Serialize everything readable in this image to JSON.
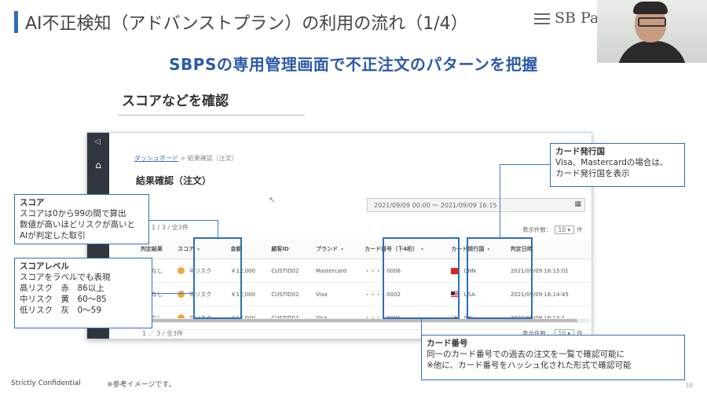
{
  "slide": {
    "title": "AI不正検知（アドバンストプラン）の利用の流れ（1/4）",
    "logo": "SB Pa",
    "subtitle": "SBPSの専用管理画面で不正注文のパターンを把握",
    "section_title": "スコアなどを確認",
    "footer_confidential": "Strictly Confidential",
    "footer_note": "※参考イメージです。",
    "page_number": "38"
  },
  "app": {
    "breadcrumb_link": "ダッシュボード",
    "breadcrumb_sep": " > ",
    "breadcrumb_current": "結果確認（注文）",
    "page_title": "結果確認（注文）",
    "date_range": "2021/09/09 00:00 ～ 2021/09/09 16:15",
    "calendar_icon": "calendar-icon",
    "pager_top": "1 / 3 / 全3件",
    "pager_bottom": "1 ／ 3 / 全3件",
    "perpage_label": "表示件数：",
    "perpage_value": "10",
    "perpage_unit": "件",
    "table": {
      "columns": [
        "判定結果",
        "スコア",
        "金額",
        "顧客ID",
        "ブランド",
        "カード番号（下4桁）",
        "カード発行国",
        "判定日時"
      ],
      "rows": [
        {
          "result": "判定なし",
          "score": "中リスク",
          "amount": "￥12,000",
          "customer": "CUSTID02",
          "brand": "Mastercard",
          "card": "・・・・0006",
          "country": "CHN",
          "flag": "cn",
          "datetime": "2021/09/09 16:15:01"
        },
        {
          "result": "判定なし",
          "score": "中リスク",
          "amount": "￥12,000",
          "customer": "CUSTID02",
          "brand": "Visa",
          "card": "・・・・0002",
          "country": "USA",
          "flag": "us",
          "datetime": "2021/09/09 16:14:45"
        },
        {
          "result": "判定なし",
          "score": "中リスク",
          "amount": "￥12,000",
          "customer": "CUSTID01",
          "brand": "Visa",
          "card": "・・・・0001",
          "country": "JPN",
          "flag": "jp",
          "datetime": "2021/09/09 16:14:1"
        }
      ]
    }
  },
  "callouts": {
    "score": {
      "title": "スコア",
      "lines": [
        "スコアは0から99の間で算出",
        "数値が高いほどリスクが高いと",
        "AIが判定した取引"
      ]
    },
    "level": {
      "title": "スコアレベル",
      "lines": [
        "スコアをラベルでも表現",
        "高リスク　赤　86以上",
        "中リスク　黄　60～85",
        "低リスク　灰　0～59"
      ]
    },
    "issuer": {
      "title": "カード発行国",
      "lines": [
        "Visa、Mastercardの場合は、",
        "カード発行国を表示"
      ]
    },
    "card": {
      "title": "カード番号",
      "lines": [
        "同一のカード番号での過去の注文を一覧で確認可能に",
        "※他に、カード番号をハッシュ化された形式で確認可能"
      ]
    }
  },
  "colors": {
    "accent": "#2d6fb6",
    "subtitle": "#2c5aa8",
    "score_medium": "#f0a540"
  }
}
